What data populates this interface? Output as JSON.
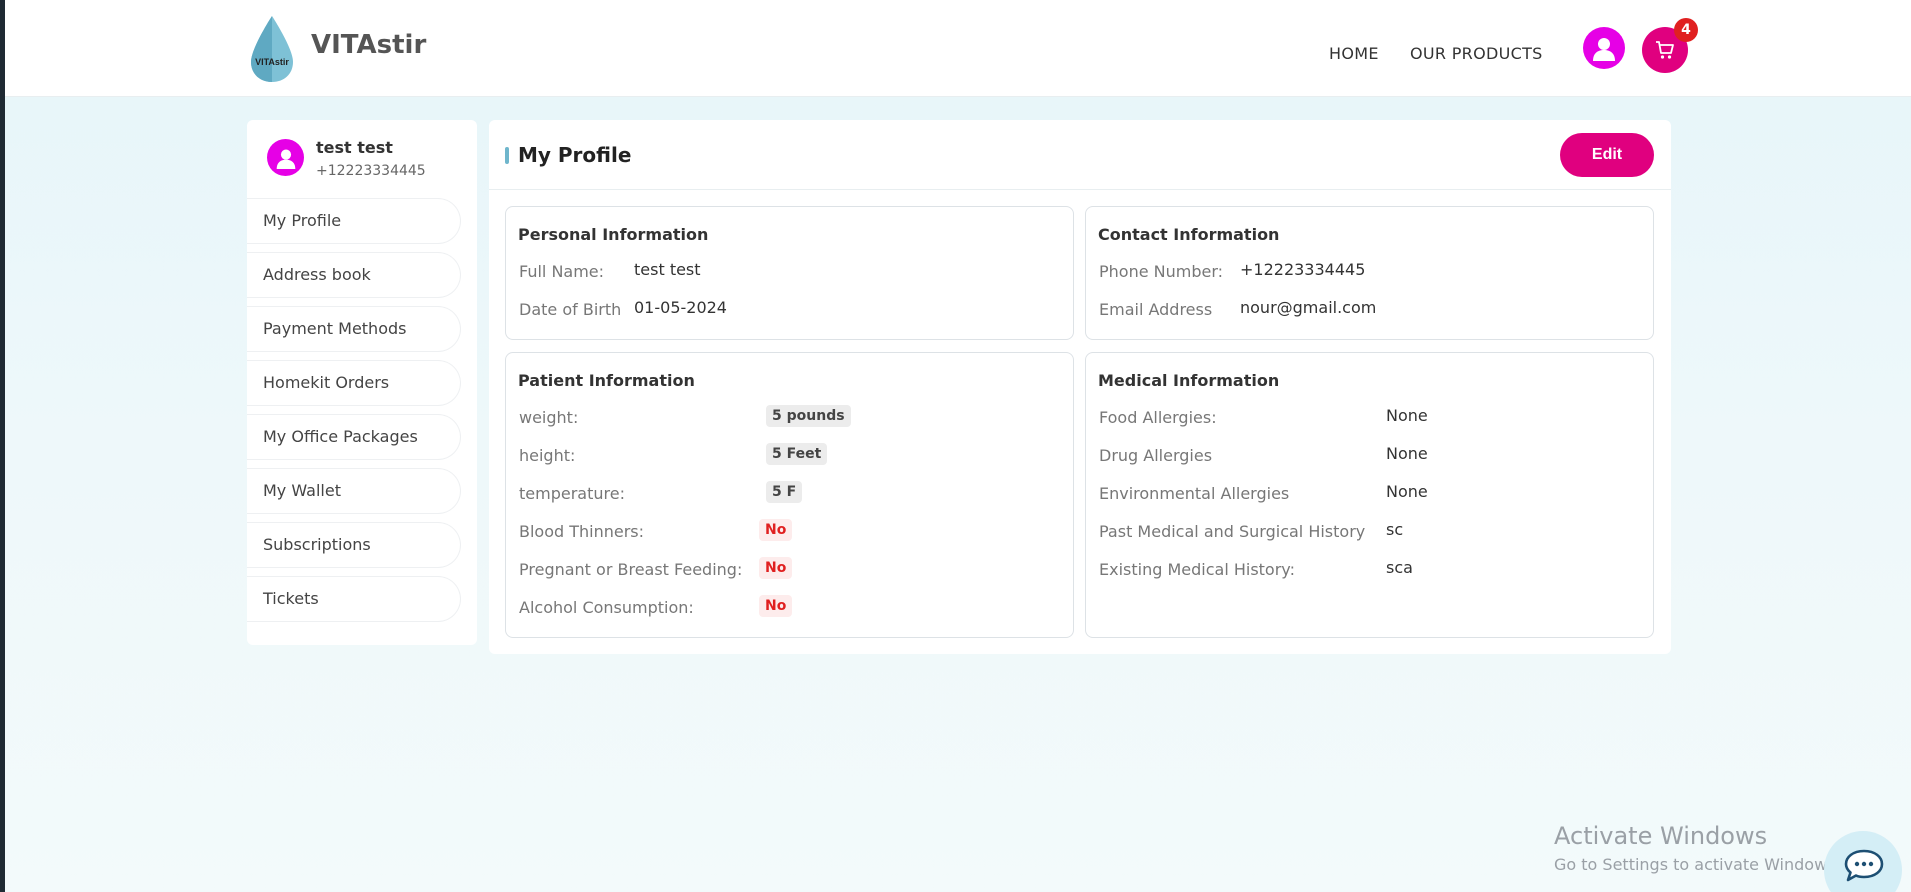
{
  "header": {
    "brand": "VITAstir",
    "logo_text": "VITAstir",
    "nav": [
      "HOME",
      "OUR PRODUCTS"
    ],
    "cart_count": "4"
  },
  "sidebar": {
    "user_name": "test test",
    "user_phone": "+12223334445",
    "items": [
      {
        "label": "My Profile"
      },
      {
        "label": "Address book"
      },
      {
        "label": "Payment Methods"
      },
      {
        "label": "Homekit Orders"
      },
      {
        "label": "My Office Packages"
      },
      {
        "label": "My Wallet"
      },
      {
        "label": "Subscriptions"
      },
      {
        "label": "Tickets"
      }
    ]
  },
  "main": {
    "title": "My Profile",
    "edit_label": "Edit",
    "personal": {
      "title": "Personal Information",
      "full_name_label": "Full Name:",
      "full_name": "test test",
      "dob_label": "Date of Birth",
      "dob": "01-05-2024"
    },
    "contact": {
      "title": "Contact Information",
      "phone_label": "Phone Number:",
      "phone": "+12223334445",
      "email_label": "Email Address",
      "email": "nour@gmail.com"
    },
    "patient": {
      "title": "Patient Information",
      "weight_label": "weight:",
      "weight": "5 pounds",
      "height_label": "height:",
      "height": "5 Feet",
      "temperature_label": "temperature:",
      "temperature": "5 F",
      "blood_thinners_label": "Blood Thinners:",
      "blood_thinners": "No",
      "pregnant_label": "Pregnant or Breast Feeding:",
      "pregnant": "No",
      "alcohol_label": "Alcohol Consumption:",
      "alcohol": "No"
    },
    "medical": {
      "title": "Medical Information",
      "food_label": "Food Allergies:",
      "food": "None",
      "drug_label": "Drug Allergies",
      "drug": "None",
      "env_label": "Environmental Allergies",
      "env": "None",
      "past_label": "Past Medical and Surgical History",
      "past": "sc",
      "existing_label": "Existing Medical History:",
      "existing": "sca"
    }
  },
  "watermark": {
    "title": "Activate Windows",
    "subtitle": "Go to Settings to activate Windows."
  },
  "colors": {
    "accent_pink": "#e0007f",
    "avatar_magenta": "#e600e6",
    "badge_red": "#e02020",
    "logo_blue": "#6fb6cc"
  },
  "icons": {
    "logo": "water-drop-icon",
    "user": "user-icon",
    "cart": "cart-icon",
    "chat": "chat-icon"
  }
}
